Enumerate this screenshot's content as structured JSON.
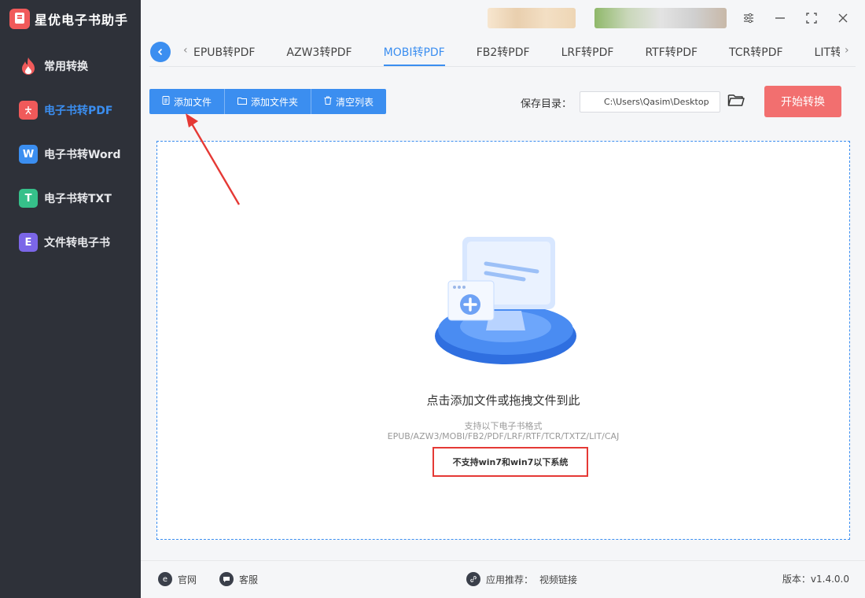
{
  "app": {
    "name": "星优电子书助手"
  },
  "sidebar": {
    "items": [
      {
        "label": "常用转换",
        "icon": "flame-icon",
        "color": "#f05a5a",
        "glyph": "🔥"
      },
      {
        "label": "电子书转PDF",
        "icon": "pdf-icon",
        "color": "#f05a5a",
        "glyph": "⅄"
      },
      {
        "label": "电子书转Word",
        "icon": "word-icon",
        "color": "#3b8ef0",
        "glyph": "W"
      },
      {
        "label": "电子书转TXT",
        "icon": "txt-icon",
        "color": "#36c08a",
        "glyph": "T"
      },
      {
        "label": "文件转电子书",
        "icon": "ebook-icon",
        "color": "#7b66e8",
        "glyph": "E"
      }
    ],
    "active_index": 1
  },
  "tabs": [
    {
      "label": "EPUB转PDF"
    },
    {
      "label": "AZW3转PDF"
    },
    {
      "label": "MOBI转PDF"
    },
    {
      "label": "FB2转PDF"
    },
    {
      "label": "LRF转PDF"
    },
    {
      "label": "RTF转PDF"
    },
    {
      "label": "TCR转PDF"
    },
    {
      "label": "LIT转"
    }
  ],
  "active_tab": 2,
  "toolbar": {
    "add_file": "添加文件",
    "add_folder": "添加文件夹",
    "clear_list": "清空列表"
  },
  "save": {
    "label": "保存目录：",
    "path": "C:\\Users\\Qasim\\Desktop"
  },
  "start_button": "开始转换",
  "dropzone": {
    "title": "点击添加文件或拖拽文件到此",
    "support_title": "支持以下电子书格式",
    "formats": "EPUB/AZW3/MOBI/FB2/PDF/LRF/RTF/TCR/TXTZ/LIT/CAJ",
    "warning": "不支持win7和win7以下系统"
  },
  "footer": {
    "website": "官网",
    "service": "客服",
    "recommend_label": "应用推荐：",
    "recommend_link": "视频链接",
    "version": "版本：v1.4.0.0"
  },
  "colors": {
    "accent": "#3b8ef0",
    "start": "#f26f6f",
    "sidebar_bg": "#2e3139",
    "warning_border": "#e53935"
  }
}
